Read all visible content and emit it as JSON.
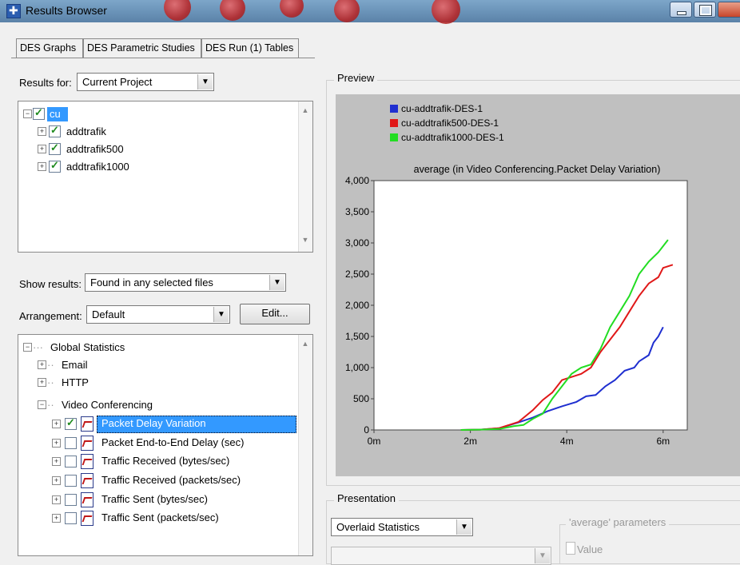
{
  "window": {
    "title": "Results Browser"
  },
  "tabs": [
    "DES Graphs",
    "DES Parametric Studies",
    "DES Run (1) Tables"
  ],
  "results_for": {
    "label": "Results for:",
    "value": "Current Project"
  },
  "project_tree": {
    "root": "cu",
    "children": [
      "addtrafik",
      "addtrafik500",
      "addtrafik1000"
    ]
  },
  "show_results": {
    "label": "Show results:",
    "value": "Found in any selected files"
  },
  "arrangement": {
    "label": "Arrangement:",
    "value": "Default",
    "edit_label": "Edit..."
  },
  "stats_tree": {
    "root": "Global Statistics",
    "groups": [
      "Email",
      "HTTP",
      "Video Conferencing"
    ],
    "items": [
      {
        "label": "Packet Delay Variation",
        "checked": true,
        "selected": true
      },
      {
        "label": "Packet End-to-End Delay (sec)",
        "checked": false,
        "selected": false
      },
      {
        "label": "Traffic Received (bytes/sec)",
        "checked": false,
        "selected": false
      },
      {
        "label": "Traffic Received (packets/sec)",
        "checked": false,
        "selected": false
      },
      {
        "label": "Traffic Sent (bytes/sec)",
        "checked": false,
        "selected": false
      },
      {
        "label": "Traffic Sent (packets/sec)",
        "checked": false,
        "selected": false
      }
    ]
  },
  "preview": {
    "group_title": "Preview"
  },
  "presentation": {
    "group_title": "Presentation",
    "mode_value": "Overlaid Statistics",
    "params_title": "'average' parameters",
    "value_label": "Value"
  },
  "colors": {
    "selection": "#3399ff",
    "plot_bg": "#c0c0c0",
    "series1": "#1f2fd0",
    "series2": "#e01818",
    "series3": "#22dd22"
  },
  "chart_data": {
    "type": "line",
    "title": "average (in Video Conferencing.Packet Delay Variation)",
    "xlabel": "",
    "ylabel": "",
    "x_ticks": [
      "0m",
      "2m",
      "4m",
      "6m"
    ],
    "y_ticks": [
      "0",
      "500",
      "1,000",
      "1,500",
      "2,000",
      "2,500",
      "3,000",
      "3,500",
      "4,000"
    ],
    "xlim": [
      0,
      6.5
    ],
    "ylim": [
      0,
      4000
    ],
    "legend_position": "top-left",
    "series": [
      {
        "name": "cu-addtrafik-DES-1",
        "color": "#1f2fd0",
        "points": [
          [
            1.8,
            0
          ],
          [
            2.2,
            5
          ],
          [
            2.6,
            30
          ],
          [
            3.0,
            120
          ],
          [
            3.3,
            200
          ],
          [
            3.6,
            300
          ],
          [
            3.9,
            380
          ],
          [
            4.2,
            450
          ],
          [
            4.4,
            540
          ],
          [
            4.6,
            560
          ],
          [
            4.8,
            700
          ],
          [
            5.0,
            800
          ],
          [
            5.2,
            950
          ],
          [
            5.4,
            1000
          ],
          [
            5.5,
            1100
          ],
          [
            5.7,
            1200
          ],
          [
            5.8,
            1400
          ],
          [
            5.9,
            1500
          ],
          [
            6.0,
            1650
          ]
        ]
      },
      {
        "name": "cu-addtrafik500-DES-1",
        "color": "#e01818",
        "points": [
          [
            1.8,
            0
          ],
          [
            2.2,
            5
          ],
          [
            2.6,
            30
          ],
          [
            3.0,
            130
          ],
          [
            3.3,
            320
          ],
          [
            3.5,
            480
          ],
          [
            3.7,
            600
          ],
          [
            3.9,
            800
          ],
          [
            4.1,
            850
          ],
          [
            4.3,
            900
          ],
          [
            4.5,
            1000
          ],
          [
            4.7,
            1250
          ],
          [
            4.9,
            1450
          ],
          [
            5.1,
            1650
          ],
          [
            5.3,
            1900
          ],
          [
            5.5,
            2150
          ],
          [
            5.7,
            2350
          ],
          [
            5.9,
            2450
          ],
          [
            6.0,
            2600
          ],
          [
            6.2,
            2650
          ]
        ]
      },
      {
        "name": "cu-addtrafik1000-DES-1",
        "color": "#22dd22",
        "points": [
          [
            1.8,
            0
          ],
          [
            2.2,
            5
          ],
          [
            2.6,
            15
          ],
          [
            2.9,
            60
          ],
          [
            3.1,
            80
          ],
          [
            3.3,
            180
          ],
          [
            3.5,
            260
          ],
          [
            3.7,
            500
          ],
          [
            3.9,
            700
          ],
          [
            4.1,
            900
          ],
          [
            4.3,
            1000
          ],
          [
            4.5,
            1050
          ],
          [
            4.7,
            1300
          ],
          [
            4.9,
            1650
          ],
          [
            5.1,
            1900
          ],
          [
            5.3,
            2150
          ],
          [
            5.5,
            2500
          ],
          [
            5.7,
            2700
          ],
          [
            5.9,
            2850
          ],
          [
            6.1,
            3050
          ]
        ]
      }
    ]
  }
}
